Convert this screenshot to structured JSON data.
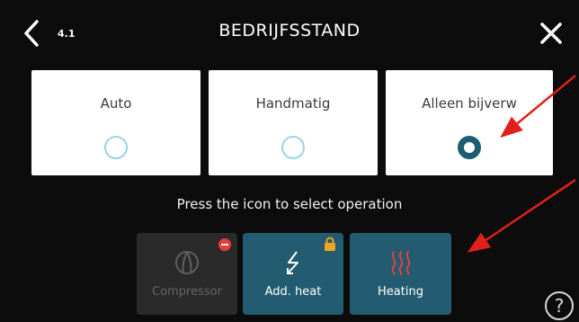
{
  "header": {
    "menu_number": "4.1",
    "title": "BEDRIJFSSTAND",
    "back_icon": "chevron-left-icon",
    "close_icon": "close-icon"
  },
  "modes": [
    {
      "label": "Auto",
      "selected": false
    },
    {
      "label": "Handmatig",
      "selected": false
    },
    {
      "label": "Alleen bijverw",
      "selected": true
    }
  ],
  "instruction": "Press the icon to select operation",
  "tiles": [
    {
      "label": "Compressor",
      "icon": "compressor-icon",
      "state": "disabled",
      "badge": "blocked"
    },
    {
      "label": "Add. heat",
      "icon": "add-heat-icon",
      "state": "active",
      "badge": "locked"
    },
    {
      "label": "Heating",
      "icon": "heating-icon",
      "state": "active",
      "badge": ""
    }
  ],
  "help": {
    "label": "?"
  },
  "colors": {
    "background": "#0c0c0c",
    "card": "#ffffff",
    "radio_outline": "#9bd2e4",
    "radio_selected": "#1f5c73",
    "tile_active": "#235c70",
    "tile_disabled": "#2a2a2a",
    "badge_red": "#e63b3b",
    "badge_lock": "#f0a51e",
    "heating_icon": "#e0423a",
    "annotation_arrow": "#e0201a"
  }
}
